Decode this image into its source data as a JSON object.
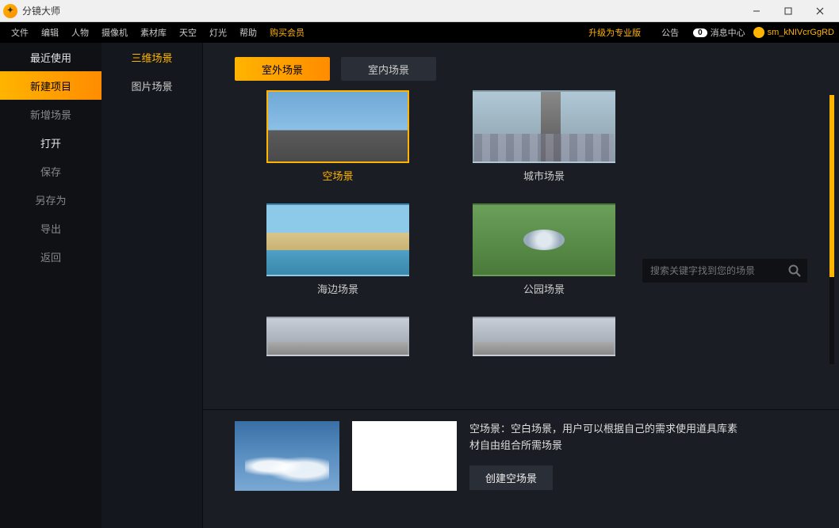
{
  "titlebar": {
    "app_name": "分镜大师"
  },
  "menubar": {
    "items": [
      "文件",
      "编辑",
      "人物",
      "摄像机",
      "素材库",
      "天空",
      "灯光",
      "帮助"
    ],
    "purchase": "购买会员",
    "upgrade": "升级为专业版",
    "announce": "公告",
    "msg_count": "0",
    "msg_label": "消息中心",
    "username": "sm_kNIVcrGgRD"
  },
  "sidebar1": {
    "items": [
      {
        "label": "最近使用",
        "active": false,
        "light": true
      },
      {
        "label": "新建项目",
        "active": true
      },
      {
        "label": "新增场景",
        "active": false
      },
      {
        "label": "打开",
        "active": false,
        "light": true
      },
      {
        "label": "保存",
        "active": false
      },
      {
        "label": "另存为",
        "active": false
      },
      {
        "label": "导出",
        "active": false
      },
      {
        "label": "返回",
        "active": false
      }
    ]
  },
  "sidebar2": {
    "items": [
      {
        "label": "三维场景",
        "active": true
      },
      {
        "label": "图片场景",
        "active": false
      }
    ]
  },
  "tabs": {
    "items": [
      {
        "label": "室外场景",
        "active": true
      },
      {
        "label": "室内场景",
        "active": false
      }
    ]
  },
  "scenes": [
    {
      "label": "空场景",
      "selected": true,
      "thumb_class": "thumb-sky"
    },
    {
      "label": "城市场景",
      "selected": false,
      "thumb_class": "thumb-city"
    },
    {
      "label": "海边场景",
      "selected": false,
      "thumb_class": "thumb-beach"
    },
    {
      "label": "公园场景",
      "selected": false,
      "thumb_class": "thumb-park"
    },
    {
      "label": "",
      "selected": false,
      "thumb_class": "thumb-interior"
    },
    {
      "label": "",
      "selected": false,
      "thumb_class": "thumb-interior"
    }
  ],
  "search": {
    "placeholder": "搜索关键字找到您的场景"
  },
  "detail": {
    "description": "空场景：空白场景，用户可以根据自己的需求使用道具库素材自由组合所需场景",
    "create_label": "创建空场景"
  }
}
